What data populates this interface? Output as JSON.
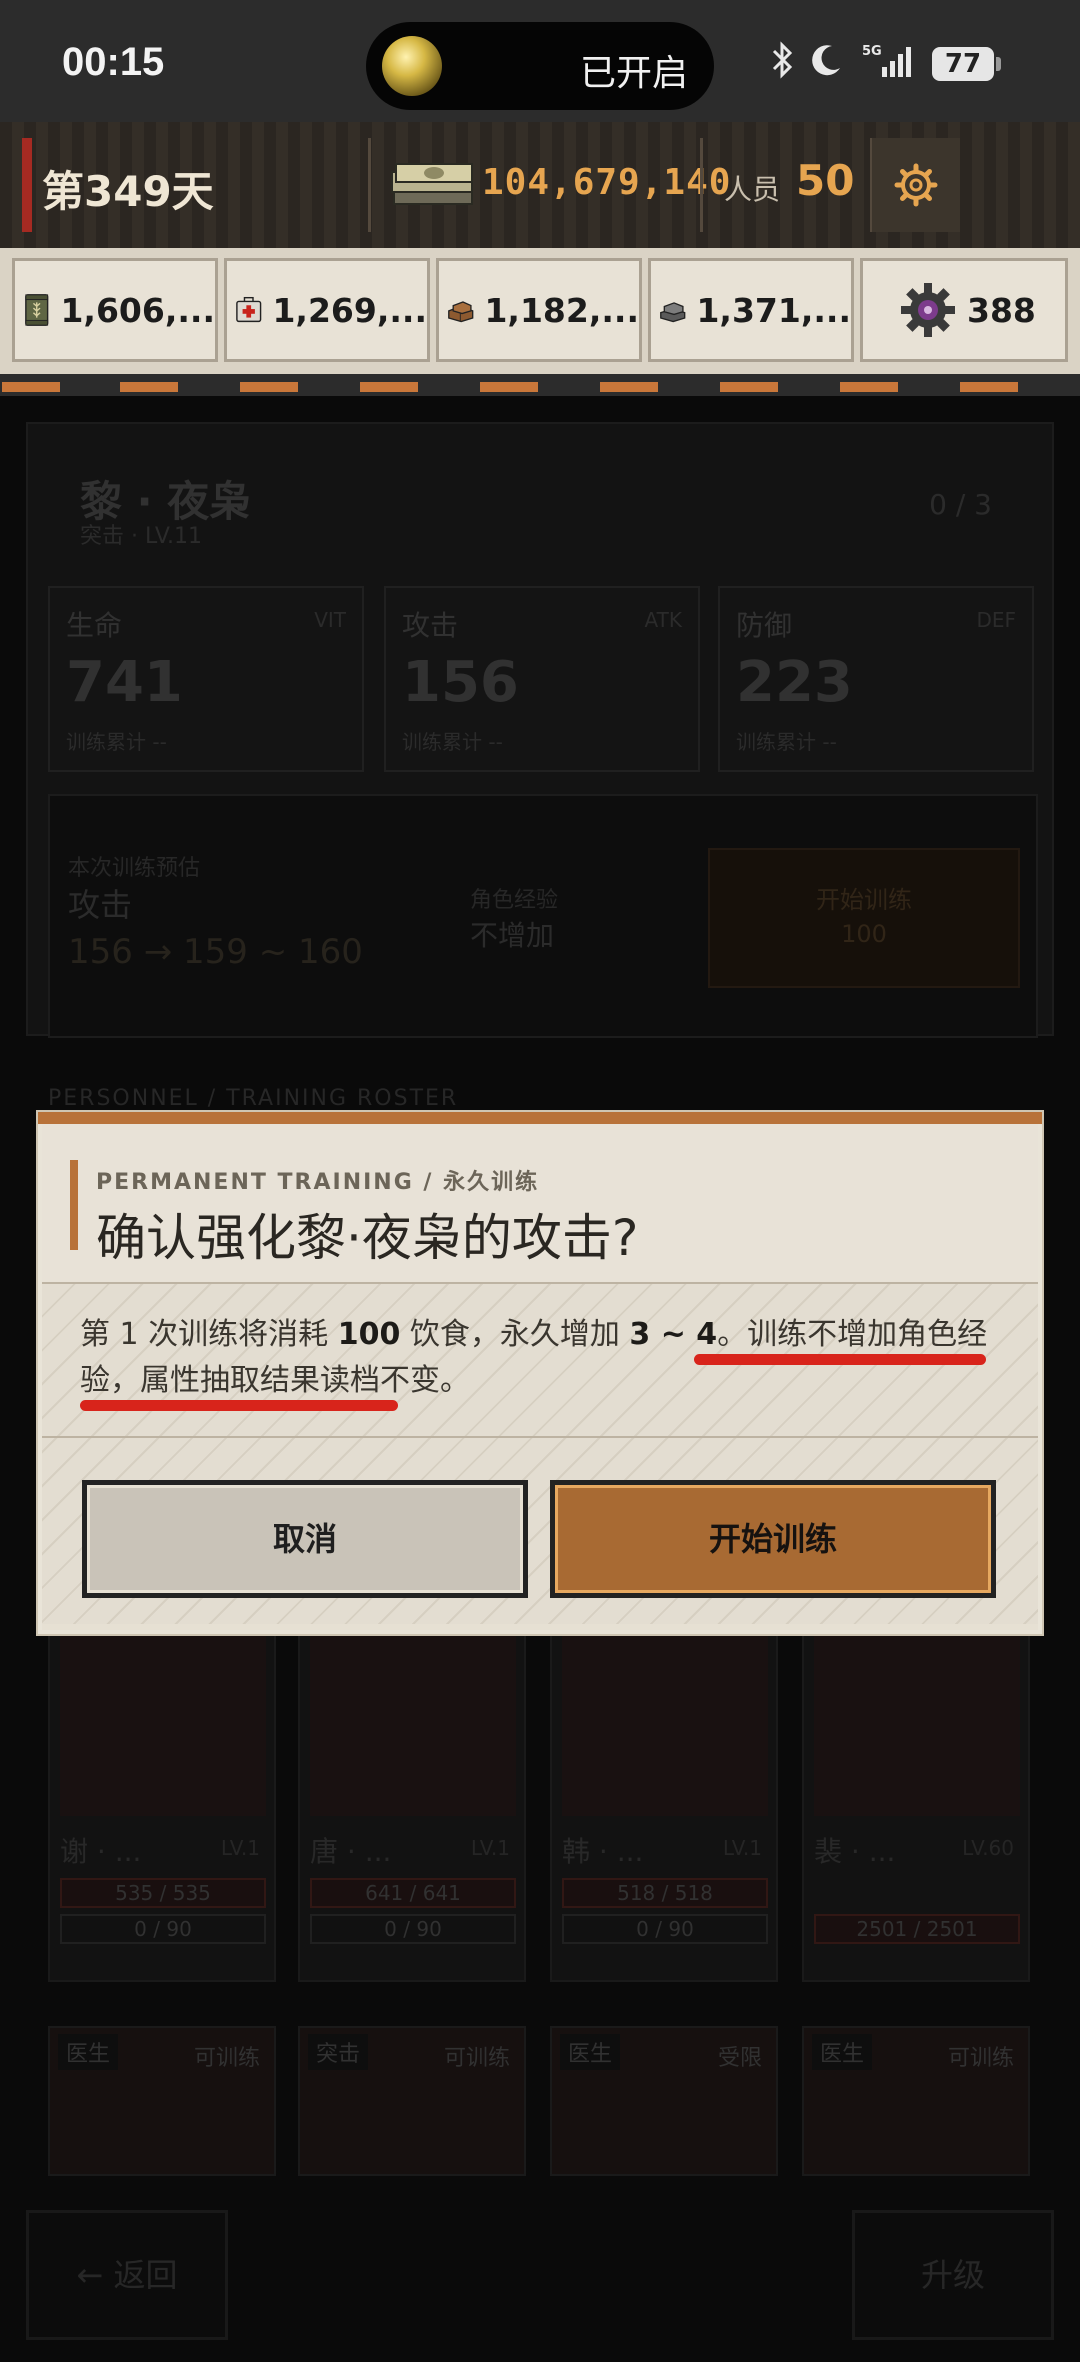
{
  "status_bar": {
    "time": "00:15",
    "island_text": "已开启",
    "battery": "77",
    "icons": [
      "bluetooth-icon",
      "moon-icon",
      "signal-5g-icon",
      "battery-icon"
    ]
  },
  "topbar": {
    "day": "第349天",
    "money": "104,679,140",
    "staff_label": "人员",
    "staff_count": "50"
  },
  "resources": [
    {
      "icon": "food-can-icon",
      "value": "1,606,..."
    },
    {
      "icon": "medkit-icon",
      "value": "1,269,..."
    },
    {
      "icon": "wood-icon",
      "value": "1,182,..."
    },
    {
      "icon": "metal-icon",
      "value": "1,371,..."
    },
    {
      "icon": "gear-part-icon",
      "value": "388"
    }
  ],
  "background": {
    "char_name": "黎 · 夜枭",
    "char_sub": "突击 · LV.11",
    "char_progress": "0 / 3",
    "stats": [
      {
        "label": "生命",
        "abbr": "VIT",
        "value": "741",
        "sub": "训练累计 --"
      },
      {
        "label": "攻击",
        "abbr": "ATK",
        "value": "156",
        "sub": "训练累计 --"
      },
      {
        "label": "防御",
        "abbr": "DEF",
        "value": "223",
        "sub": "训练累计 --"
      }
    ],
    "train_preview": {
      "label": "本次训练预估",
      "attr": "攻击",
      "range": "156 → 159 ~ 160",
      "exp_label": "角色经验",
      "exp_value": "不增加",
      "start_label": "开始训练",
      "cost": "100"
    },
    "roster_header": "PERSONNEL / TRAINING ROSTER",
    "roster": [
      {
        "name": "谢 · ...",
        "lv": "LV.1",
        "hp": "535 / 535",
        "exp": "0 / 90"
      },
      {
        "name": "唐 · ...",
        "lv": "LV.1",
        "hp": "641 / 641",
        "exp": "0 / 90"
      },
      {
        "name": "韩 · ...",
        "lv": "LV.1",
        "hp": "518 / 518",
        "exp": "0 / 90"
      },
      {
        "name": "裴 · ...",
        "lv": "LV.60",
        "hp": "2501 / 2501",
        "exp": ""
      }
    ],
    "roster2": [
      {
        "tag": "医生",
        "state": "可训练"
      },
      {
        "tag": "突击",
        "state": "可训练"
      },
      {
        "tag": "医生",
        "state": "受限"
      },
      {
        "tag": "医生",
        "state": "可训练"
      }
    ],
    "back_label": "返回",
    "upgrade_label": "升级"
  },
  "modal": {
    "kicker": "PERMANENT TRAINING / 永久训练",
    "title": "确认强化黎·夜枭的攻击?",
    "text_1": "第 1 次训练将消耗 ",
    "cost": "100",
    "text_2": " 饮食，永久增加 ",
    "gain": "3 ~ 4",
    "text_3": "。训练不增加角色经验，属性抽取结果读档不变。",
    "cancel_label": "取消",
    "confirm_label": "开始训练"
  }
}
